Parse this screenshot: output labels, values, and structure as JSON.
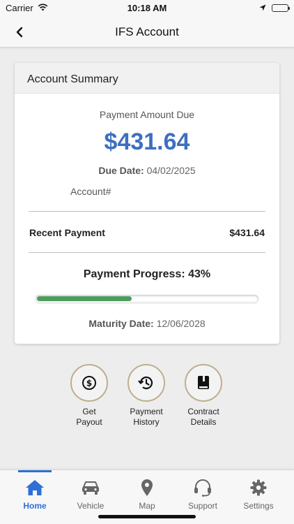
{
  "status_bar": {
    "carrier": "Carrier",
    "time": "10:18 AM"
  },
  "nav": {
    "title": "IFS Account"
  },
  "summary": {
    "header": "Account Summary",
    "payment_amount_due_label": "Payment Amount Due",
    "payment_amount_due": "$431.64",
    "due_date_label": "Due Date:",
    "due_date": "04/02/2025",
    "account_label": "Account#",
    "recent_payment_label": "Recent Payment",
    "recent_payment_value": "$431.64",
    "progress_label": "Payment Progress: 43%",
    "progress_fraction": 0.43,
    "maturity_date_label": "Maturity Date:",
    "maturity_date": "12/06/2028"
  },
  "actions": [
    {
      "line1": "Get",
      "line2": "Payout",
      "icon": "dollar-circle-icon"
    },
    {
      "line1": "Payment",
      "line2": "History",
      "icon": "history-clock-icon"
    },
    {
      "line1": "Contract",
      "line2": "Details",
      "icon": "book-icon"
    }
  ],
  "tabs": [
    {
      "label": "Home",
      "icon": "home-icon",
      "active": true
    },
    {
      "label": "Vehicle",
      "icon": "car-icon",
      "active": false
    },
    {
      "label": "Map",
      "icon": "map-pin-icon",
      "active": false
    },
    {
      "label": "Support",
      "icon": "headset-icon",
      "active": false
    },
    {
      "label": "Settings",
      "icon": "gear-icon",
      "active": false
    }
  ],
  "colors": {
    "accent": "#3d6fbf",
    "progress": "#4f9d5e",
    "tab_active": "#2f6fd6",
    "action_ring": "#bfae8f"
  }
}
